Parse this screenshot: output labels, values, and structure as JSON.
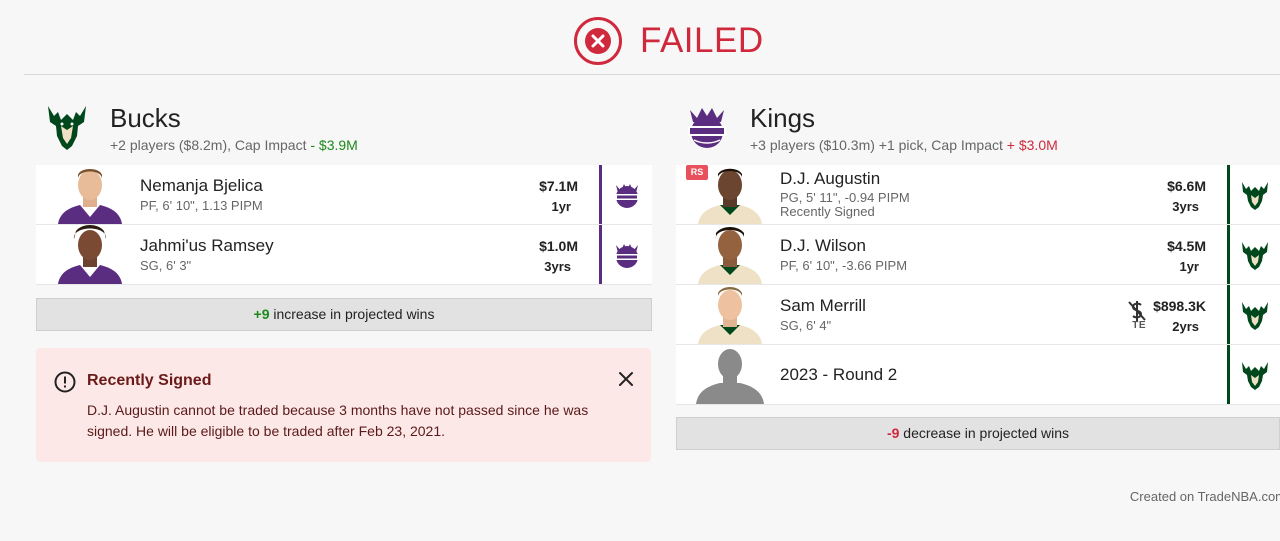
{
  "status": {
    "label": "FAILED",
    "color": "#d0283c"
  },
  "left_team": {
    "name": "Bucks",
    "summary": "+2 players ($8.2m), Cap Impact",
    "cap_impact": "- $3.9M",
    "players": [
      {
        "name": "Nemanja Bjelica",
        "meta": "PF, 6' 10\", 1.13 PIPM",
        "salary": "$7.1M",
        "years": "1yr",
        "dest": "kings"
      },
      {
        "name": "Jahmi'us Ramsey",
        "meta": "SG, 6' 3\"",
        "salary": "$1.0M",
        "years": "3yrs",
        "dest": "kings"
      }
    ],
    "wins_value": "+9",
    "wins_text": "increase in projected wins"
  },
  "right_team": {
    "name": "Kings",
    "summary": "+3 players ($10.3m) +1 pick, Cap Impact",
    "cap_impact": "+ $3.0M",
    "players": [
      {
        "badge": "RS",
        "name": "D.J. Augustin",
        "meta": "PG, 5' 11\", -0.94 PIPM",
        "meta2": "Recently Signed",
        "salary": "$6.6M",
        "years": "3yrs",
        "dest": "bucks"
      },
      {
        "name": "D.J. Wilson",
        "meta": "PF, 6' 10\", -3.66 PIPM",
        "salary": "$4.5M",
        "years": "1yr",
        "dest": "bucks"
      },
      {
        "name": "Sam Merrill",
        "meta": "SG, 6' 4\"",
        "salary": "$898.3K",
        "years": "2yrs",
        "te_label": "TE",
        "dest": "bucks"
      },
      {
        "name": "2023 - Round 2",
        "dest": "bucks"
      }
    ],
    "wins_value": "-9",
    "wins_text": "decrease in projected wins"
  },
  "alert": {
    "title": "Recently Signed",
    "body": "D.J. Augustin cannot be traded because 3 months have not passed since he was signed. He will be eligible to be traded after Feb 23, 2021."
  },
  "footer": "Created on TradeNBA.com",
  "icons": {
    "status": "x-circle-icon",
    "alert": "exclamation-circle-icon",
    "close": "close-icon",
    "trade_exception": "no-dollar-icon"
  },
  "colors": {
    "bucks": "#00471b",
    "kings": "#5a2d81",
    "positive": "#1b8a1b",
    "negative": "#d0283c",
    "alert_bg": "#fde8e8"
  }
}
